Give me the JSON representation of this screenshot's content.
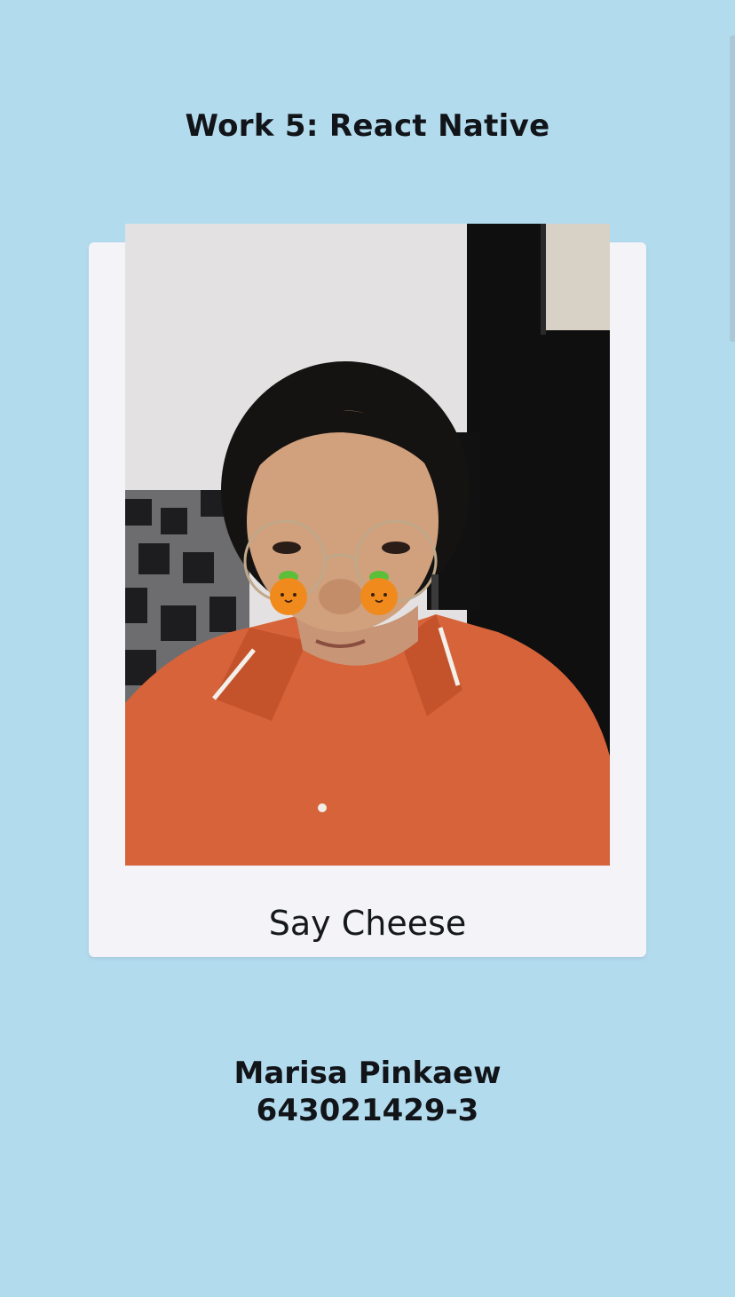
{
  "header": {
    "title": "Work 5: React Native"
  },
  "card": {
    "photo_alt": "Selfie photo with orange face stickers",
    "caption": "Say Cheese"
  },
  "footer": {
    "name": "Marisa Pinkaew",
    "student_id": "643021429-3"
  },
  "colors": {
    "background": "#b3dbee",
    "card": "#f4f3f8",
    "text": "#111418",
    "shirt": "#d9643a",
    "sticker": "#f08a1c"
  },
  "icons": [
    "orange-sticker-icon"
  ]
}
